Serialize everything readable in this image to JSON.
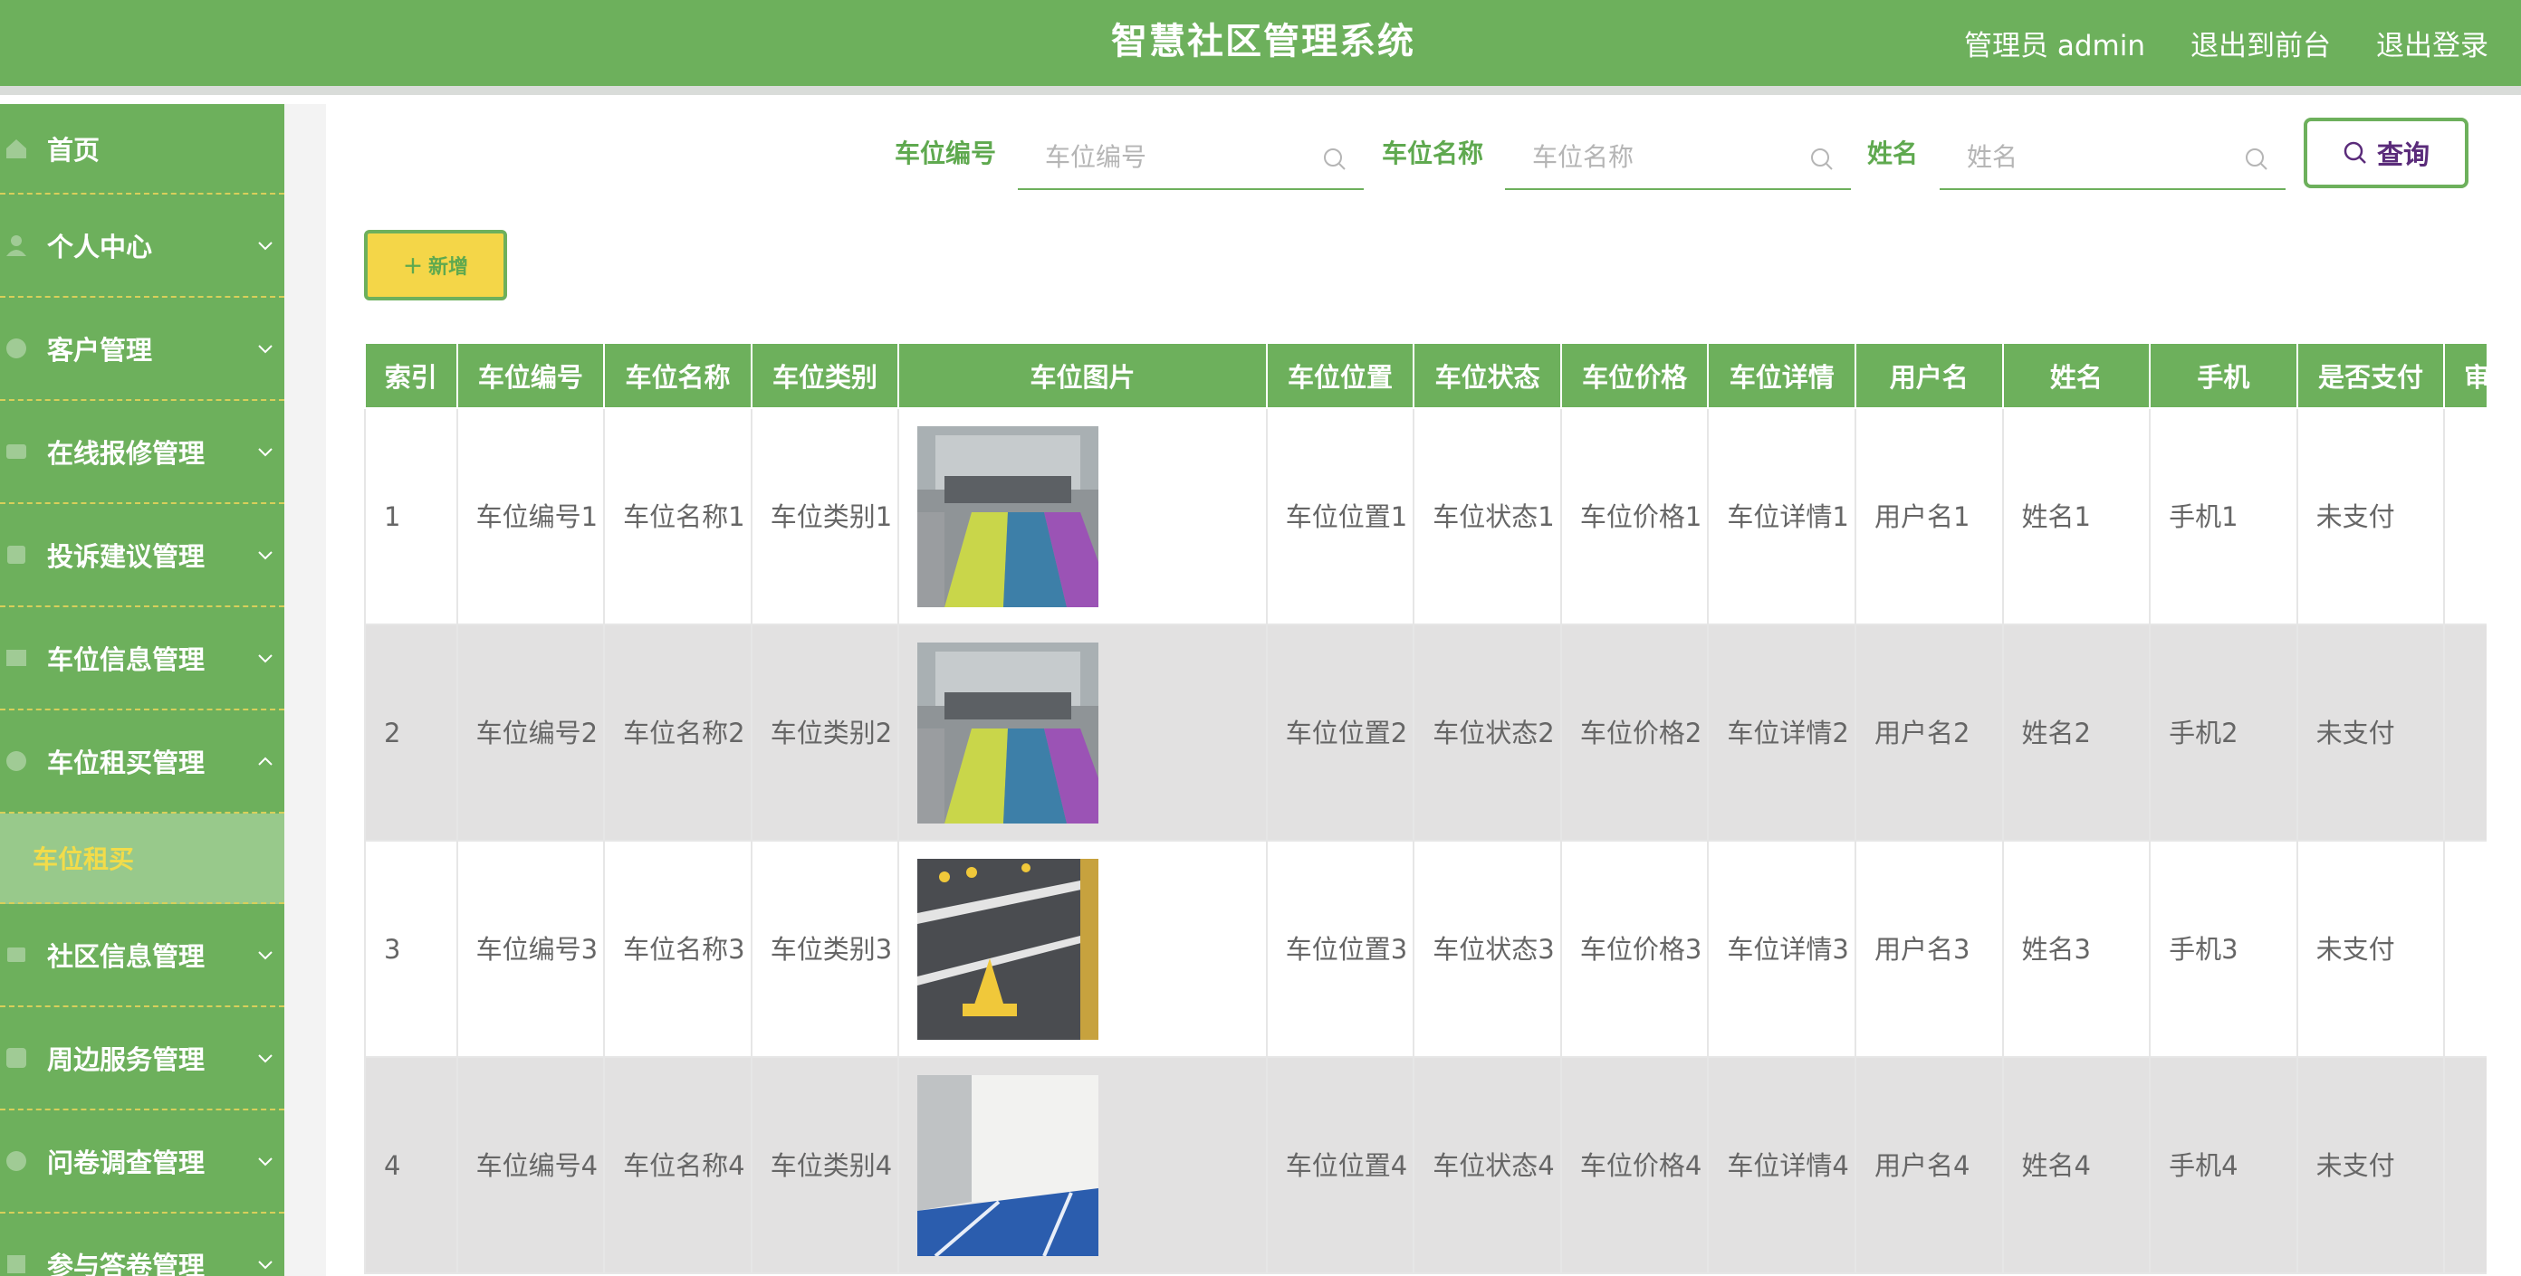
{
  "header": {
    "title": "智慧社区管理系统",
    "admin": "管理员 admin",
    "back_front": "退出到前台",
    "logout": "退出登录"
  },
  "sidebar": {
    "items": [
      {
        "label": "首页",
        "icon": "home-icon",
        "expandable": false
      },
      {
        "label": "个人中心",
        "icon": "user-icon",
        "expandable": true
      },
      {
        "label": "客户管理",
        "icon": "customer-icon",
        "expandable": true
      },
      {
        "label": "在线报修管理",
        "icon": "repair-icon",
        "expandable": true
      },
      {
        "label": "投诉建议管理",
        "icon": "complaint-icon",
        "expandable": true
      },
      {
        "label": "车位信息管理",
        "icon": "parking-icon",
        "expandable": true
      },
      {
        "label": "车位租买管理",
        "icon": "rent-icon",
        "expandable": true,
        "expanded": true
      },
      {
        "label": "社区信息管理",
        "icon": "community-icon",
        "expandable": true
      },
      {
        "label": "周边服务管理",
        "icon": "service-icon",
        "expandable": true
      },
      {
        "label": "问卷调查管理",
        "icon": "survey-icon",
        "expandable": true
      },
      {
        "label": "参与答卷管理",
        "icon": "answer-icon",
        "expandable": true
      }
    ],
    "active_sub": "车位租买"
  },
  "search": {
    "fields": [
      {
        "label": "车位编号",
        "placeholder": "车位编号"
      },
      {
        "label": "车位名称",
        "placeholder": "车位名称"
      },
      {
        "label": "姓名",
        "placeholder": "姓名"
      }
    ],
    "query_label": "查询"
  },
  "toolbar": {
    "add_label": "新增"
  },
  "table": {
    "columns": [
      "索引",
      "车位编号",
      "车位名称",
      "车位类别",
      "车位图片",
      "车位位置",
      "车位状态",
      "车位价格",
      "车位详情",
      "用户名",
      "姓名",
      "手机",
      "是否支付",
      "审核"
    ],
    "rows": [
      {
        "index": "1",
        "code": "车位编号1",
        "name": "车位名称1",
        "category": "车位类别1",
        "location": "车位位置1",
        "status": "车位状态1",
        "price": "车位价格1",
        "detail": "车位详情1",
        "username": "用户名1",
        "realname": "姓名1",
        "phone": "手机1",
        "paid": "未支付",
        "image": "parking-lot-colored-photo"
      },
      {
        "index": "2",
        "code": "车位编号2",
        "name": "车位名称2",
        "category": "车位类别2",
        "location": "车位位置2",
        "status": "车位状态2",
        "price": "车位价格2",
        "detail": "车位详情2",
        "username": "用户名2",
        "realname": "姓名2",
        "phone": "手机2",
        "paid": "未支付",
        "image": "parking-lot-colored-photo"
      },
      {
        "index": "3",
        "code": "车位编号3",
        "name": "车位名称3",
        "category": "车位类别3",
        "location": "车位位置3",
        "status": "车位状态3",
        "price": "车位价格3",
        "detail": "车位详情3",
        "username": "用户名3",
        "realname": "姓名3",
        "phone": "手机3",
        "paid": "未支付",
        "image": "parking-lock-photo"
      },
      {
        "index": "4",
        "code": "车位编号4",
        "name": "车位名称4",
        "category": "车位类别4",
        "location": "车位位置4",
        "status": "车位状态4",
        "price": "车位价格4",
        "detail": "车位详情4",
        "username": "用户名4",
        "realname": "姓名4",
        "phone": "手机4",
        "paid": "未支付",
        "image": "parking-blue-space-photo"
      }
    ]
  },
  "colors": {
    "primary": "#6db05c",
    "accent_yellow": "#f4d648",
    "row_alt": "#e2e1e1"
  }
}
